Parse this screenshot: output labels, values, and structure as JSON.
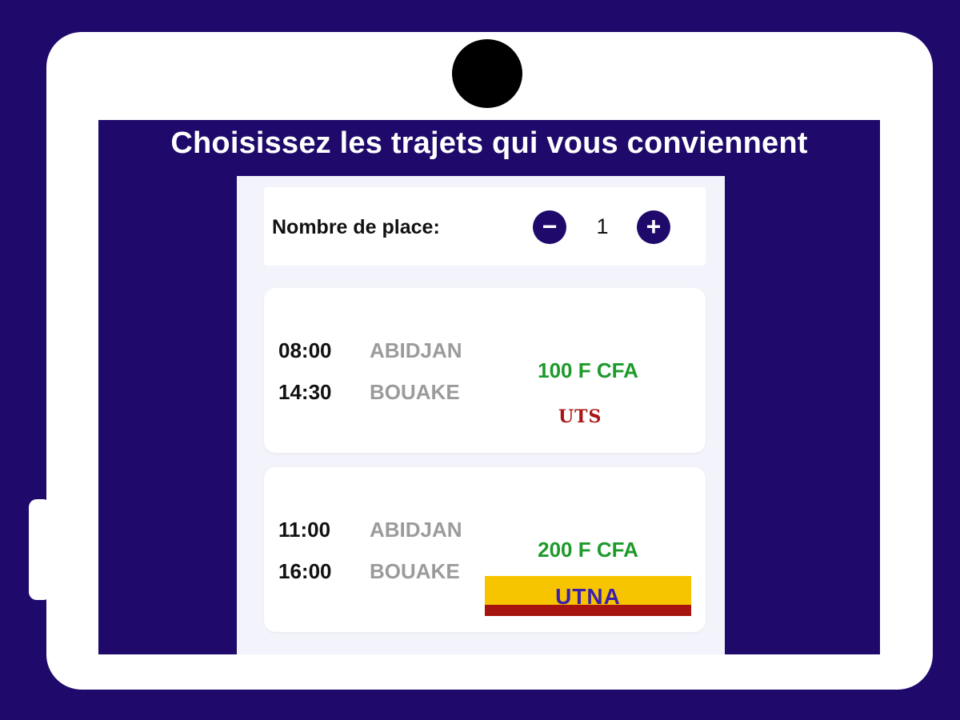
{
  "headline": "Choisissez les trajets qui vous conviennent",
  "seats": {
    "label": "Nombre de place:",
    "count": "1",
    "minus_icon": "minus-icon",
    "plus_icon": "plus-icon"
  },
  "trips": [
    {
      "departure_time": "08:00",
      "arrival_time": "14:30",
      "from": "ABIDJAN",
      "to": "BOUAKE",
      "price": "100 F CFA",
      "company": "UTS"
    },
    {
      "departure_time": "11:00",
      "arrival_time": "16:00",
      "from": "ABIDJAN",
      "to": "BOUAKE",
      "price": "200 F CFA",
      "company": "UTNA"
    }
  ],
  "colors": {
    "brand": "#1f0a6b",
    "price": "#1c9a2a",
    "city": "#9b9b9b",
    "uts_logo": "#a91616",
    "utna_yellow": "#f7c500",
    "utna_red": "#a61410"
  }
}
